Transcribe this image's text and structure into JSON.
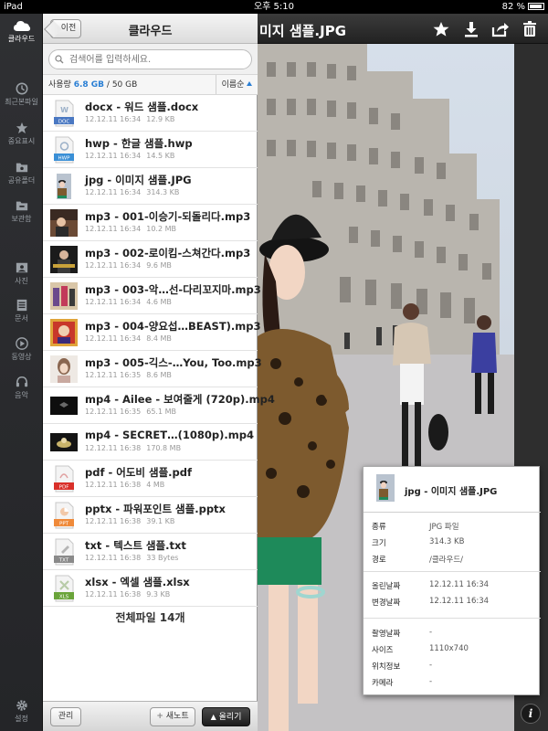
{
  "status_bar": {
    "device": "iPad",
    "time": "오후 5:10",
    "battery": "82 %"
  },
  "rail": {
    "brand": "클라우드",
    "items": [
      {
        "label": "최근본파일",
        "icon": "recent-icon"
      },
      {
        "label": "중요표시",
        "icon": "star-icon"
      },
      {
        "label": "공유폴더",
        "icon": "shared-folder-icon"
      },
      {
        "label": "보관함",
        "icon": "archive-icon"
      },
      {
        "label": "사진",
        "icon": "photo-icon"
      },
      {
        "label": "문서",
        "icon": "document-icon"
      },
      {
        "label": "동영상",
        "icon": "video-icon"
      },
      {
        "label": "음악",
        "icon": "music-icon"
      },
      {
        "label": "설정",
        "icon": "gear-icon"
      }
    ]
  },
  "panel": {
    "back_label": "이전",
    "title": "클라우드",
    "search_placeholder": "검색어를 입력하세요.",
    "usage_label": "사용량",
    "usage_used": "6.8 GB",
    "usage_total": "/ 50 GB",
    "sort_label": "이름순",
    "total_files": "전체파일 14개",
    "manage_label": "관리",
    "new_note_label": "새노트",
    "upload_label": "올리기"
  },
  "files": [
    {
      "name": "docx - 워드 샘플.docx",
      "date": "12.12.11 16:34",
      "size": "12.9 KB",
      "type": "DOC"
    },
    {
      "name": "hwp - 한글 샘플.hwp",
      "date": "12.12.11 16:34",
      "size": "14.5 KB",
      "type": "HWP"
    },
    {
      "name": "jpg - 이미지 샘플.JPG",
      "date": "12.12.11 16:34",
      "size": "314.3 KB",
      "type": "JPG"
    },
    {
      "name": "mp3 - 001-이승기-되돌리다.mp3",
      "date": "12.12.11 16:34",
      "size": "10.2 MB",
      "type": "MP3"
    },
    {
      "name": "mp3 - 002-로이킴-스쳐간다.mp3",
      "date": "12.12.11 16:34",
      "size": "9.6 MB",
      "type": "MP3"
    },
    {
      "name": "mp3 - 003-악…선-다리꼬지마.mp3",
      "date": "12.12.11 16:34",
      "size": "4.6 MB",
      "type": "MP3"
    },
    {
      "name": "mp3 - 004-양요섭…BEAST).mp3",
      "date": "12.12.11 16:34",
      "size": "8.4 MB",
      "type": "MP3"
    },
    {
      "name": "mp3 - 005-긱스-…You, Too.mp3",
      "date": "12.12.11 16:35",
      "size": "8.6 MB",
      "type": "MP3"
    },
    {
      "name": "mp4 - Ailee - 보여줄게 (720p).mp4",
      "date": "12.12.11 16:35",
      "size": "65.1 MB",
      "type": "MP4"
    },
    {
      "name": "mp4 - SECRET…(1080p).mp4",
      "date": "12.12.11 16:38",
      "size": "170.8 MB",
      "type": "MP4"
    },
    {
      "name": "pdf - 어도비 샘플.pdf",
      "date": "12.12.11 16:38",
      "size": "4 MB",
      "type": "PDF"
    },
    {
      "name": "pptx - 파워포인트 샘플.pptx",
      "date": "12.12.11 16:38",
      "size": "39.1 KB",
      "type": "PPT"
    },
    {
      "name": "txt - 텍스트 샘플.txt",
      "date": "12.12.11 16:38",
      "size": "33 Bytes",
      "type": "TXT"
    },
    {
      "name": "xlsx - 엑셀 샘플.xlsx",
      "date": "12.12.11 16:38",
      "size": "9.3 KB",
      "type": "XLS"
    }
  ],
  "viewer": {
    "title": "미지 샘플.JPG",
    "actions": [
      "star-icon",
      "download-icon",
      "share-icon",
      "trash-icon"
    ]
  },
  "info": {
    "name": "jpg - 이미지 샘플.JPG",
    "rows_a": [
      {
        "k": "종류",
        "v": "JPG 파일"
      },
      {
        "k": "크기",
        "v": "314.3 KB"
      },
      {
        "k": "경로",
        "v": "/클라우드/"
      }
    ],
    "rows_b": [
      {
        "k": "올린날짜",
        "v": "12.12.11 16:34"
      },
      {
        "k": "변경날짜",
        "v": "12.12.11 16:34"
      }
    ],
    "rows_c": [
      {
        "k": "촬영날짜",
        "v": "-"
      },
      {
        "k": "사이즈",
        "v": "1110x740"
      },
      {
        "k": "위치정보",
        "v": "-"
      },
      {
        "k": "카메라",
        "v": "-"
      }
    ],
    "info_button": "i"
  },
  "colors": {
    "accent": "#2a7fd4",
    "rail_bg": "#2a2b2e",
    "header_bg": "#e6e6e6"
  }
}
